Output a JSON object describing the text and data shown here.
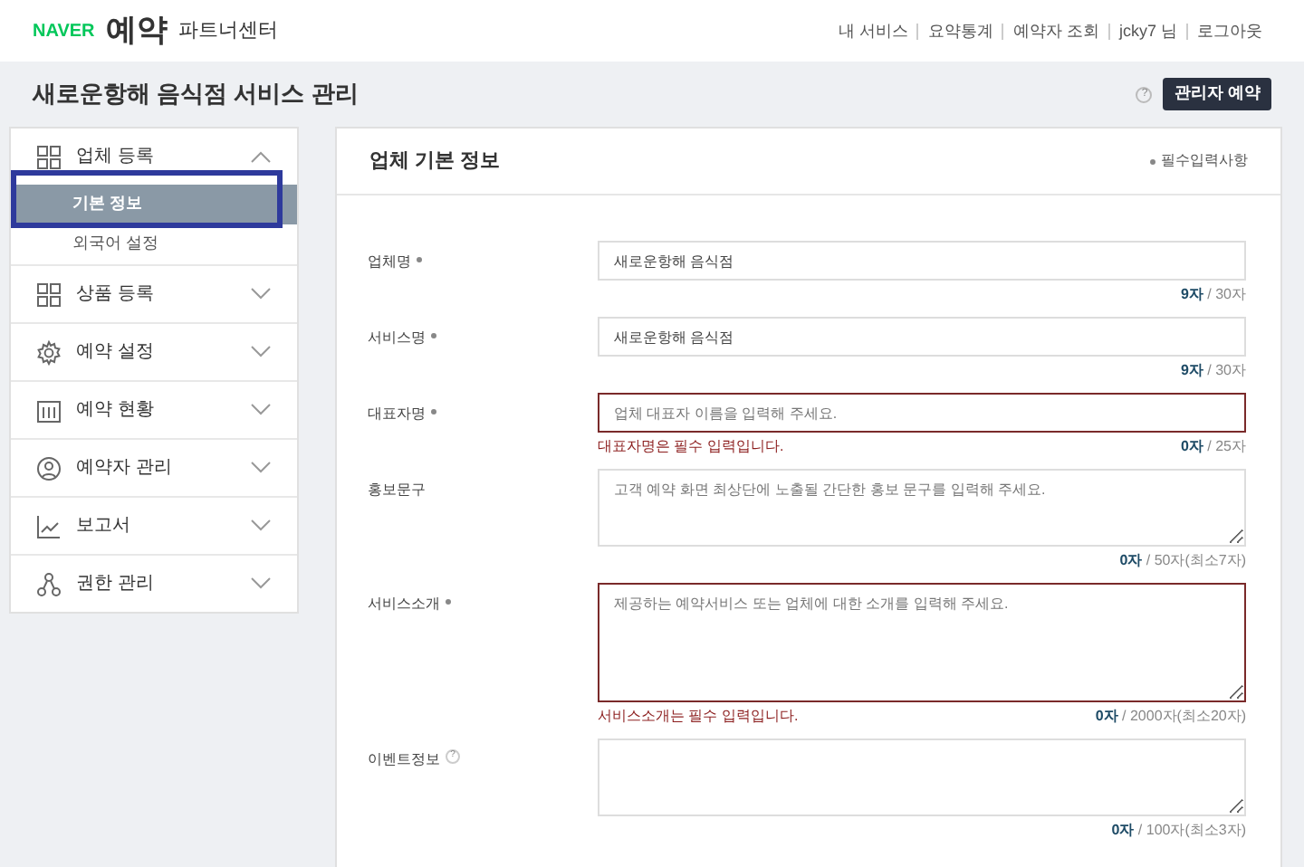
{
  "header": {
    "brand": "NAVER",
    "product": "예약",
    "subtitle": "파트너센터",
    "links": [
      "내 서비스",
      "요약통계",
      "예약자 조회",
      "jcky7 님",
      "로그아웃"
    ]
  },
  "page_title": "새로운항해 음식점 서비스 관리",
  "admin_button": {
    "help": "?",
    "label": "관리자 예약"
  },
  "sidebar": [
    {
      "kind": "grid",
      "label": "업체 등록",
      "expanded": true,
      "children": [
        {
          "label": "기본 정보",
          "selected": true
        },
        {
          "label": "외국어 설정",
          "selected": false
        }
      ]
    },
    {
      "kind": "grid",
      "label": "상품 등록",
      "expanded": false
    },
    {
      "kind": "gear",
      "label": "예약 설정",
      "expanded": false
    },
    {
      "kind": "calendar",
      "label": "예약 현황",
      "expanded": false
    },
    {
      "kind": "person",
      "label": "예약자 관리",
      "expanded": false
    },
    {
      "kind": "chart",
      "label": "보고서",
      "expanded": false
    },
    {
      "kind": "nodes",
      "label": "권한 관리",
      "expanded": false
    }
  ],
  "panel": {
    "title": "업체 기본 정보",
    "required_note": "필수입력사항",
    "fields": [
      {
        "kind": "text",
        "label": "업체명",
        "required": true,
        "help": false,
        "value": "새로운항해 음식점",
        "count": "9자",
        "limit": "/ 30자"
      },
      {
        "kind": "text",
        "label": "서비스명",
        "required": true,
        "help": false,
        "value": "새로운항해 음식점",
        "count": "9자",
        "limit": "/ 30자"
      },
      {
        "kind": "text",
        "label": "대표자명",
        "required": true,
        "help": false,
        "placeholder": "업체 대표자 이름을 입력해 주세요.",
        "error": "대표자명은 필수 입력입니다.",
        "count": "0자",
        "limit": "/ 25자"
      },
      {
        "kind": "textarea",
        "label": "홍보문구",
        "required": false,
        "help": false,
        "placeholder": "고객 예약 화면 최상단에 노출될 간단한 홍보 문구를 입력해 주세요.",
        "count": "0자",
        "limit": "/ 50자(최소7자)"
      },
      {
        "kind": "tall_textarea",
        "label": "서비스소개",
        "required": true,
        "help": false,
        "placeholder": "제공하는 예약서비스 또는 업체에 대한 소개를 입력해 주세요.",
        "error": "서비스소개는 필수 입력입니다.",
        "count": "0자",
        "limit": "/ 2000자(최소20자)"
      },
      {
        "kind": "textarea",
        "label": "이벤트정보",
        "required": false,
        "help": true,
        "count": "0자",
        "limit": "/ 100자(최소3자)"
      }
    ]
  }
}
